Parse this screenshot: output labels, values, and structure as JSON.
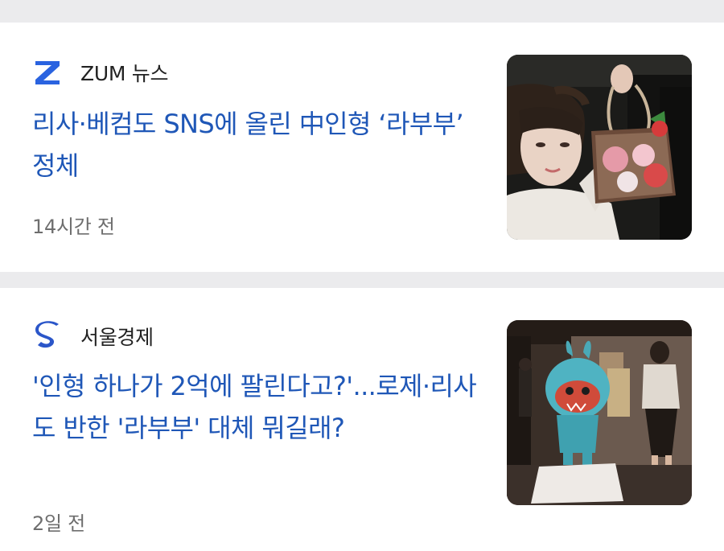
{
  "articles": [
    {
      "source": "ZUM 뉴스",
      "source_icon": "zum-logo-icon",
      "title": "리사·베컴도 SNS에 올린 中인형 ‘라부부’ 정체",
      "time": "14시간 전",
      "thumbnail_icon": "woman-holding-bag-photo"
    },
    {
      "source": "서울경제",
      "source_icon": "seoul-economic-logo-icon",
      "title": "'인형 하나가 2억에 팔린다고?'...로제·리사도 반한 '라부부' 대체 뭐길래?",
      "time": "2일 전",
      "thumbnail_icon": "labubu-figure-exhibition-photo"
    }
  ],
  "colors": {
    "headline": "#1f57b7",
    "separator": "#ebebed",
    "zum_brand": "#2a63e0",
    "seoul_brand": "#2b56c9"
  }
}
